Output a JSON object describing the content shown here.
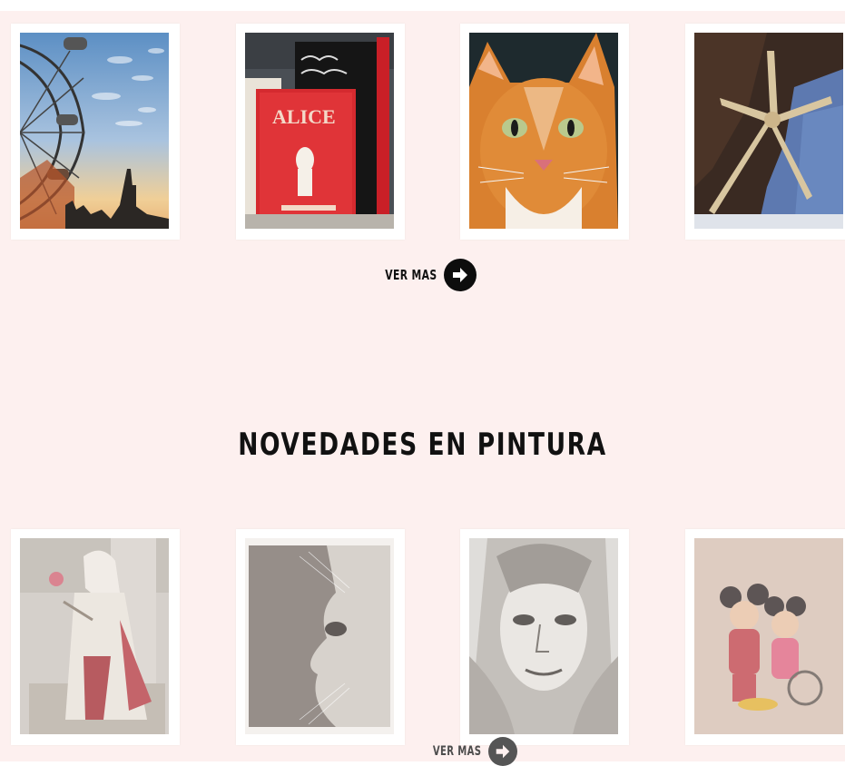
{
  "photo_section": {
    "cards": [
      {
        "name": "london-eye"
      },
      {
        "name": "alice-books"
      },
      {
        "name": "orange-cat"
      },
      {
        "name": "starfish"
      }
    ],
    "more_label": "VER MAS",
    "more_icon": "arrow-right-circle-icon"
  },
  "painting_section": {
    "title": "NOVEDADES EN PINTURA",
    "cards": [
      {
        "name": "assassin-drawing"
      },
      {
        "name": "veiled-face-drawing"
      },
      {
        "name": "woman-hood-drawing"
      },
      {
        "name": "mickey-drawing"
      }
    ],
    "more_label": "VER MAS",
    "more_icon": "arrow-right-circle-icon"
  },
  "colors": {
    "background": "#fdf0ef",
    "card": "#ffffff",
    "text": "#111111"
  }
}
